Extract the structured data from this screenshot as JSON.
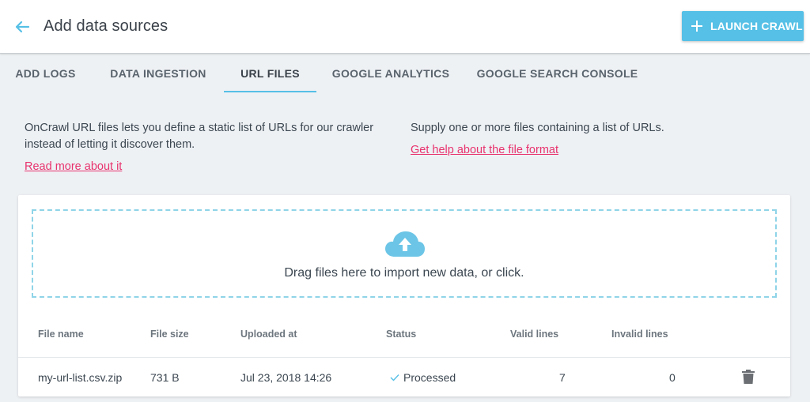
{
  "header": {
    "title": "Add data sources",
    "launch_label": "LAUNCH CRAWL",
    "back_icon": "arrow-left-icon",
    "accent_color": "#56c0e6"
  },
  "tabs": [
    {
      "label": "ADD LOGS"
    },
    {
      "label": "DATA INGESTION"
    },
    {
      "label": "URL FILES",
      "active": true
    },
    {
      "label": "GOOGLE ANALYTICS"
    },
    {
      "label": "GOOGLE SEARCH CONSOLE"
    }
  ],
  "intro": {
    "description": "OnCrawl URL files lets you define a static list of URLs for our crawler instead of letting it discover them.",
    "read_more": "Read more about it",
    "supply_text": "Supply one or more files containing a list of URLs.",
    "help_link": "Get help about the file format",
    "link_color": "#e8336e"
  },
  "dropzone": {
    "text": "Drag files here to import new data, or click.",
    "icon": "cloud-upload-icon"
  },
  "table": {
    "columns": {
      "file_name": "File name",
      "file_size": "File size",
      "uploaded_at": "Uploaded at",
      "status": "Status",
      "valid_lines": "Valid lines",
      "invalid_lines": "Invalid lines"
    },
    "rows": [
      {
        "file_name": "my-url-list.csv.zip",
        "file_size": "731 B",
        "uploaded_at": "Jul 23, 2018 14:26",
        "status": "Processed",
        "valid_lines": "7",
        "invalid_lines": "0"
      }
    ]
  }
}
